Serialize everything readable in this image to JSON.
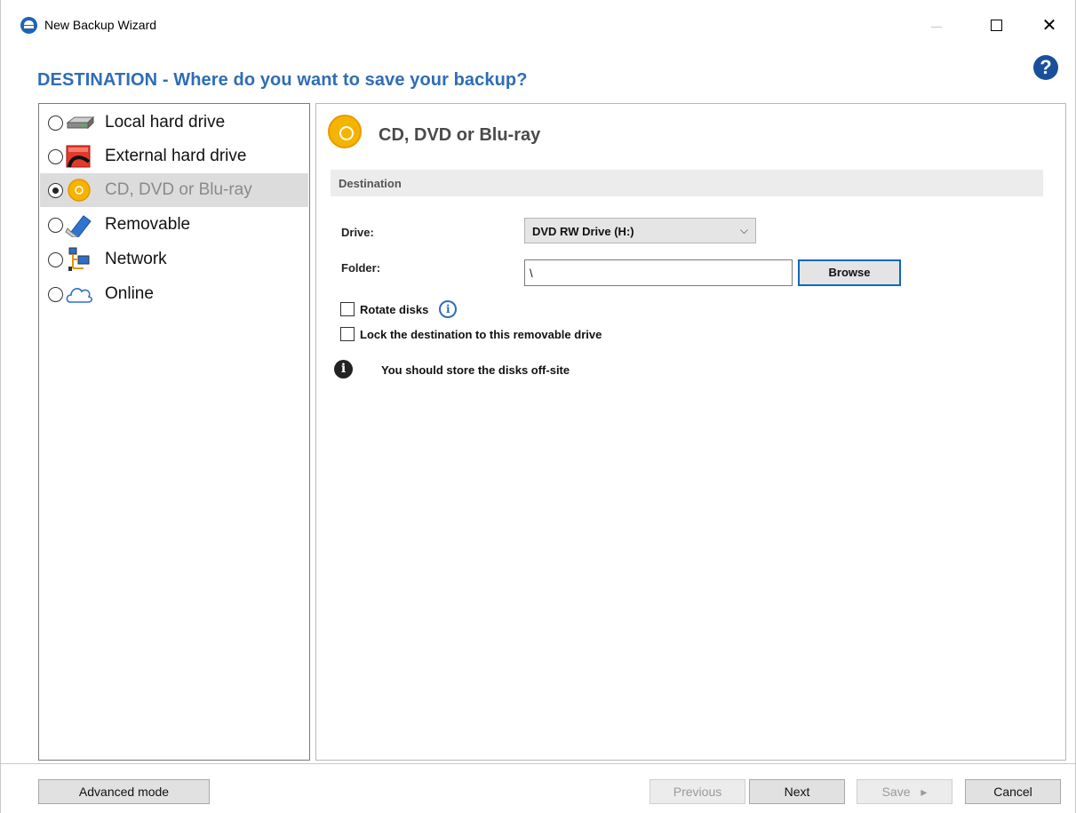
{
  "window": {
    "title": "New Backup Wizard"
  },
  "heading": "DESTINATION - Where do you want to save your backup?",
  "destinations": [
    {
      "label": "Local hard drive",
      "icon": "hard-drive-icon",
      "selected": false
    },
    {
      "label": "External hard drive",
      "icon": "external-drive-icon",
      "selected": false
    },
    {
      "label": "CD, DVD or Blu-ray",
      "icon": "disc-icon",
      "selected": true
    },
    {
      "label": "Removable",
      "icon": "usb-drive-icon",
      "selected": false
    },
    {
      "label": "Network",
      "icon": "network-icon",
      "selected": false
    },
    {
      "label": "Online",
      "icon": "cloud-icon",
      "selected": false
    }
  ],
  "panel": {
    "title": "CD, DVD or Blu-ray",
    "section": "Destination",
    "drive_label": "Drive:",
    "drive_value": "DVD RW Drive (H:)",
    "folder_label": "Folder:",
    "folder_value": "\\",
    "browse_label": "Browse",
    "rotate_label": "Rotate disks",
    "lock_label": "Lock the destination to this removable drive",
    "note": "You should store the disks off-site"
  },
  "footer": {
    "advanced": "Advanced mode",
    "previous": "Previous",
    "next": "Next",
    "save": "Save",
    "cancel": "Cancel"
  },
  "colors": {
    "heading": "#2f6db5",
    "disc_accent": "#f5b400",
    "focus_border": "#0a67c2"
  }
}
